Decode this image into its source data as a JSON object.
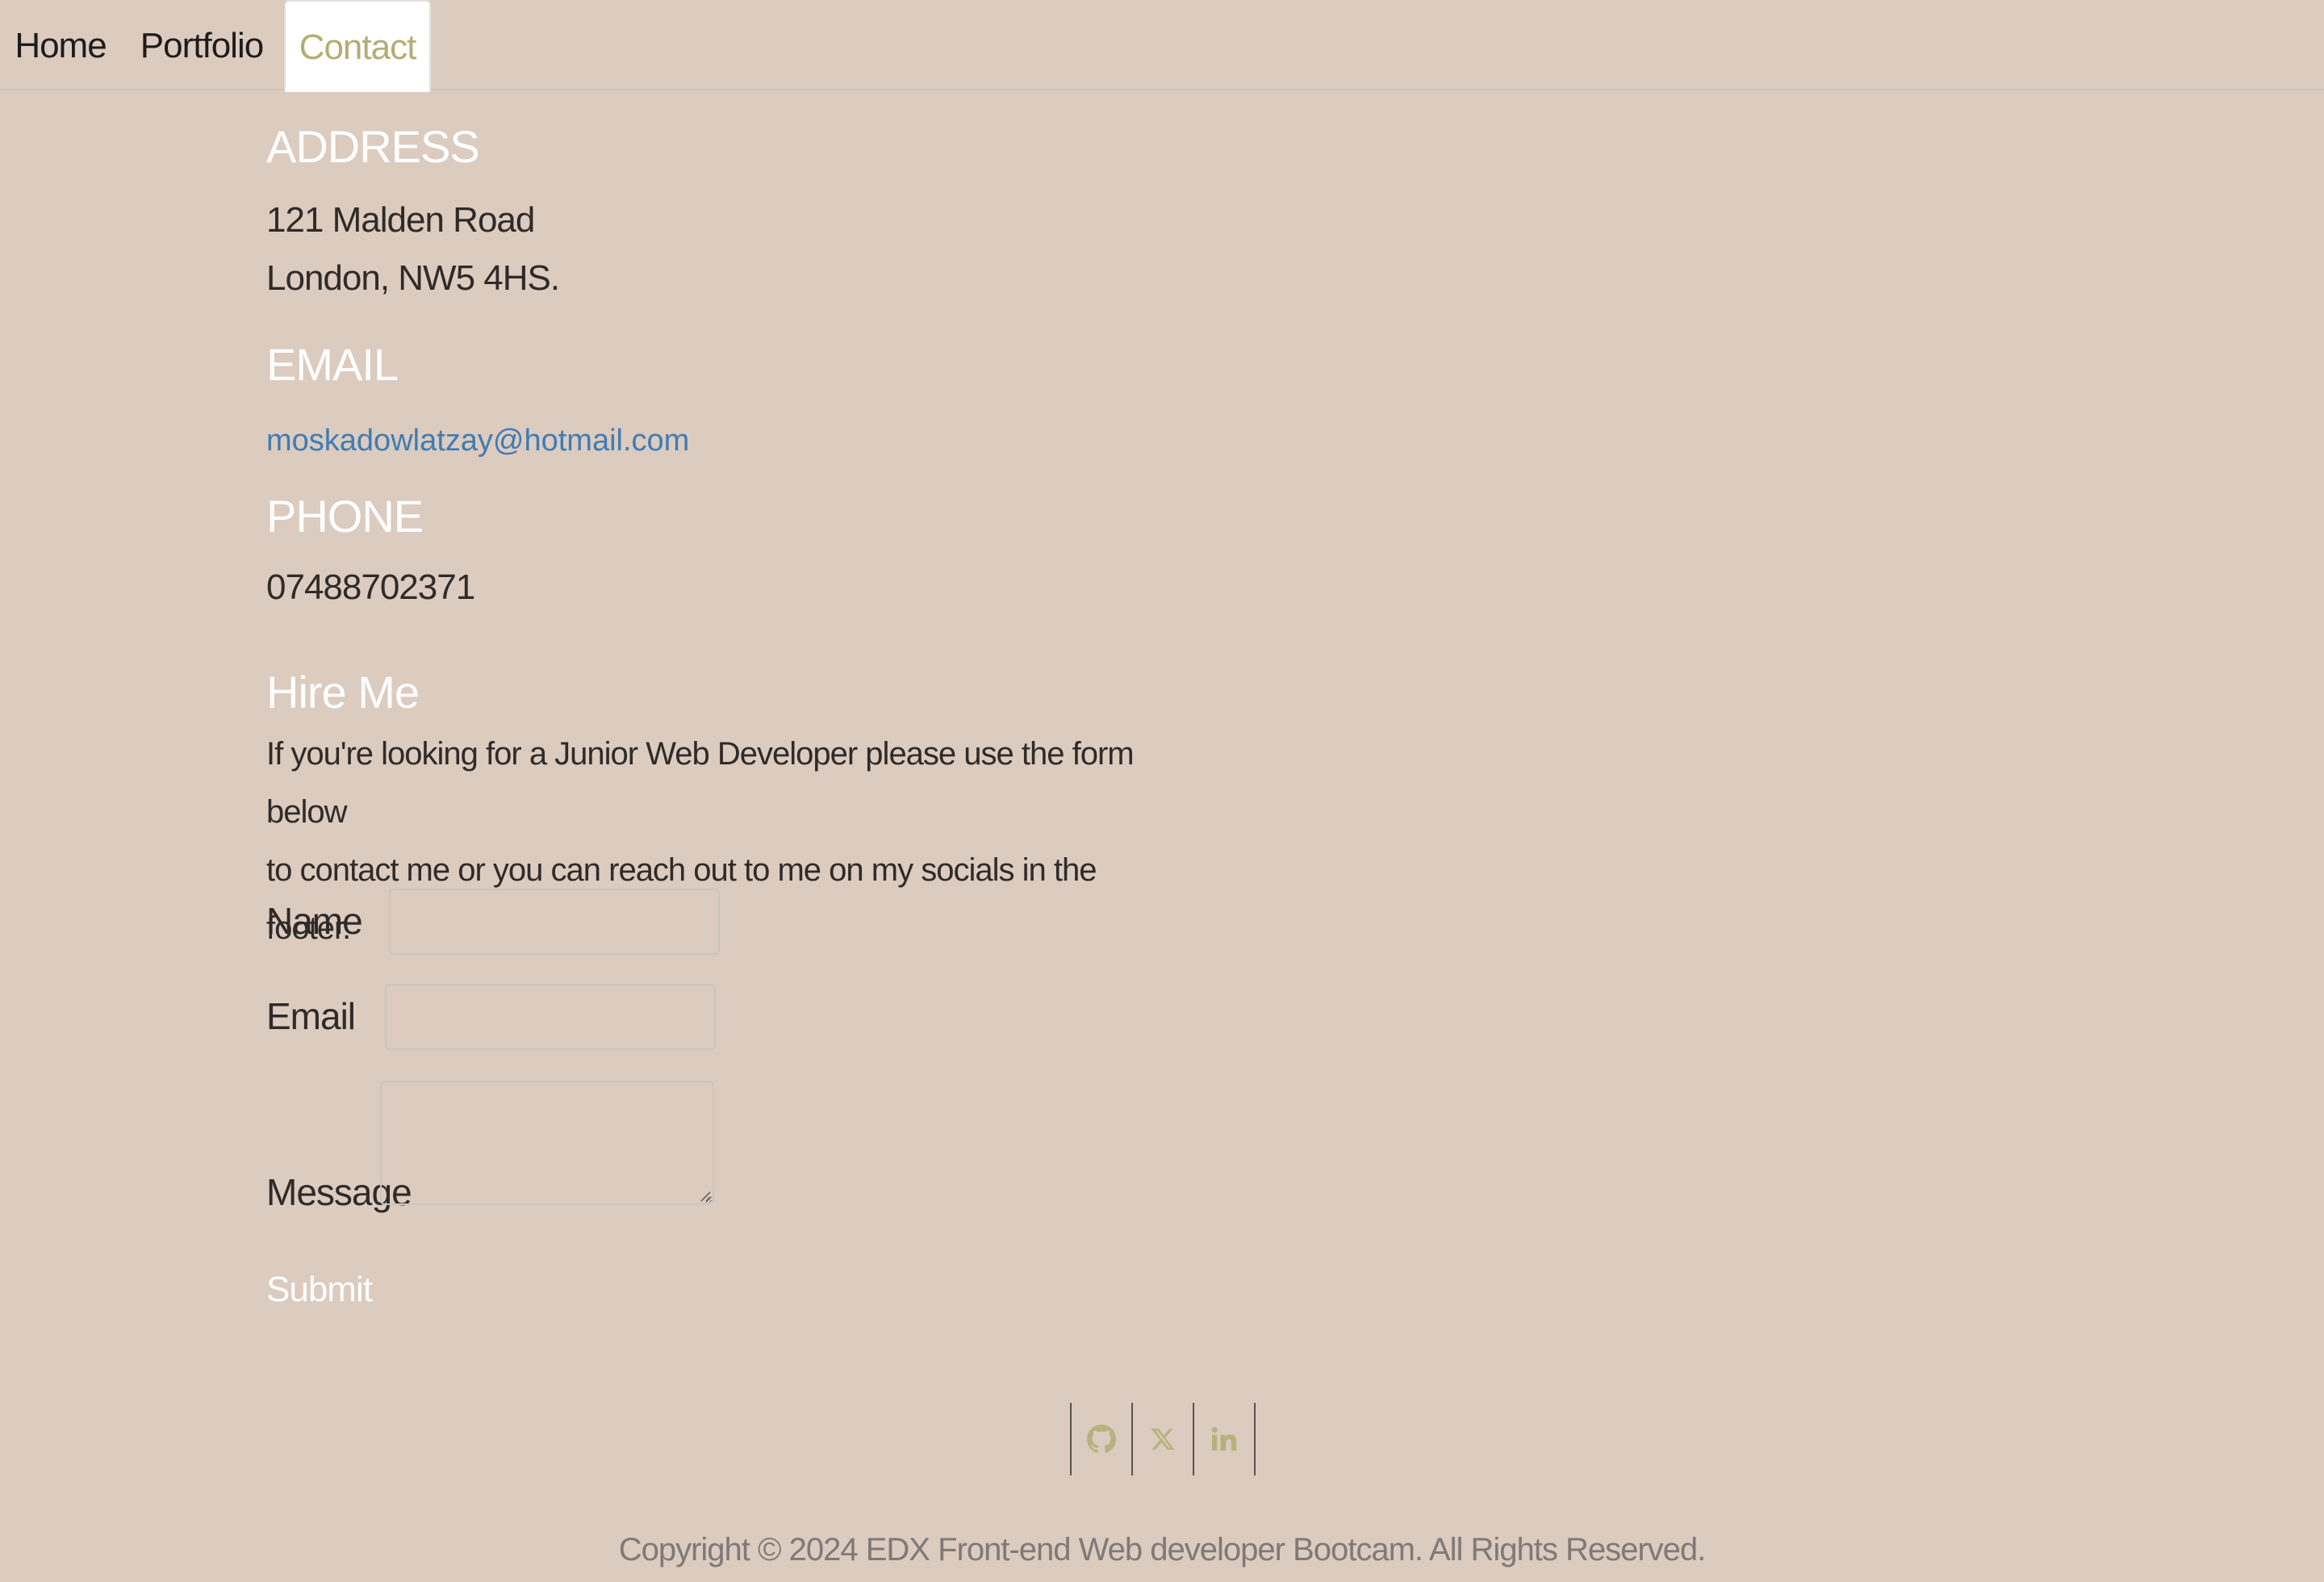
{
  "nav": {
    "items": [
      {
        "label": "Home",
        "active": false
      },
      {
        "label": "Portfolio",
        "active": false
      },
      {
        "label": "Contact",
        "active": true
      }
    ]
  },
  "contact": {
    "address_heading": "ADDRESS",
    "address_line1": "121 Malden Road",
    "address_line2": "London, NW5 4HS.",
    "email_heading": "EMAIL",
    "email_address": "moskadowlatzay@hotmail.com",
    "phone_heading": "PHONE",
    "phone_number": "07488702371"
  },
  "hire": {
    "heading": "Hire Me",
    "line1": "If you're looking for a Junior Web Developer please use the form below",
    "line2": "to contact me or you can reach out to me on my socials in the footer."
  },
  "form": {
    "name_label": "Name",
    "name_value": "",
    "email_label": "Email",
    "email_value": "",
    "message_label": "Message",
    "message_value": "",
    "submit_label": "Submit"
  },
  "footer": {
    "socials": [
      {
        "icon": "github-icon"
      },
      {
        "icon": "x-twitter-icon"
      },
      {
        "icon": "linkedin-icon"
      }
    ],
    "copyright": "Copyright © 2024 EDX Front-end Web developer Bootcam. All Rights Reserved."
  },
  "colors": {
    "background": "#dccbbf",
    "active_tab_text": "#b3ad74",
    "heading_text": "#ffffff",
    "link": "#3f7cb4",
    "social_icon": "#b6b27c"
  }
}
